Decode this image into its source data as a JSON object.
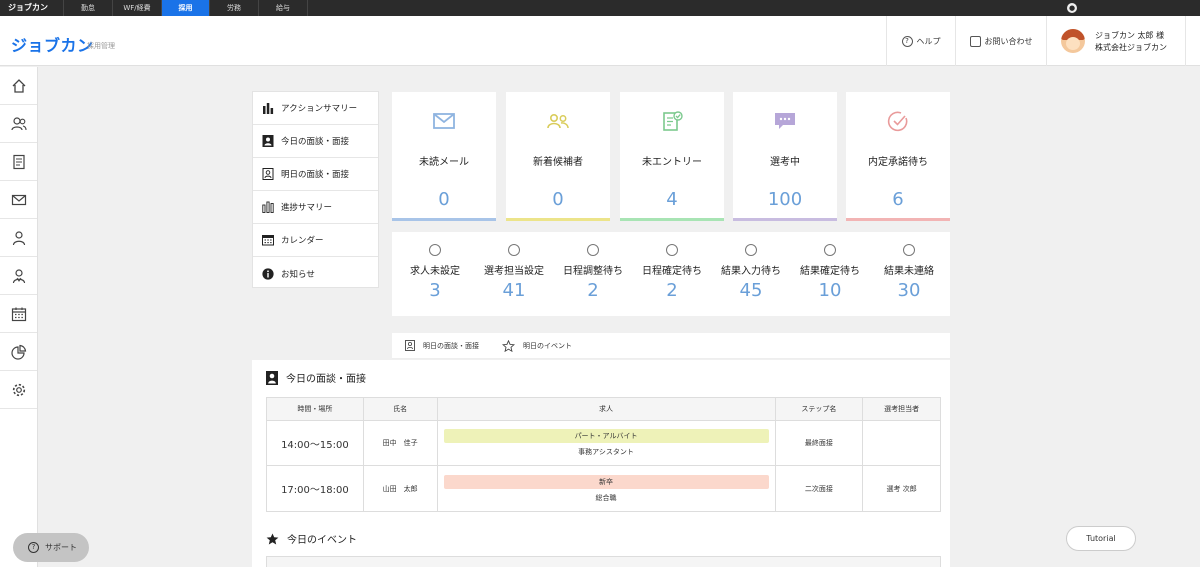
{
  "topbar": {
    "brand": "ジョブカン",
    "tabs": [
      "勤怠",
      "WF/経費",
      "採用",
      "労務",
      "給与"
    ],
    "active_tab": "採用"
  },
  "header": {
    "logo": "ジョブカン",
    "logo_sub": "採用管理",
    "help_label": "ヘルプ",
    "contact_label": "お問い合わせ",
    "user_name": "ジョブカン 太郎 様",
    "company": "株式会社ジョブカン"
  },
  "leftnav": {
    "icons": [
      "home-icon",
      "candidates-icon",
      "document-icon",
      "mail-icon",
      "person-icon",
      "users-icon",
      "calendar-icon",
      "pie-chart-icon",
      "gear-icon"
    ]
  },
  "summary_menu": [
    {
      "label": "アクションサマリー",
      "icon": "bar-chart-icon"
    },
    {
      "label": "今日の面談・面接",
      "icon": "person-card-dark-icon"
    },
    {
      "label": "明日の面談・面接",
      "icon": "person-card-icon"
    },
    {
      "label": "進捗サマリー",
      "icon": "progress-bars-icon"
    },
    {
      "label": "カレンダー",
      "icon": "calendar-icon"
    },
    {
      "label": "お知らせ",
      "icon": "info-icon"
    }
  ],
  "cards": [
    {
      "label": "未読メール",
      "value": "0",
      "color": "#a8c4e8",
      "icon": "mail-icon"
    },
    {
      "label": "新着候補者",
      "value": "0",
      "color": "#ece48a",
      "icon": "new-candidates-icon"
    },
    {
      "label": "未エントリー",
      "value": "4",
      "color": "#a8e4b4",
      "icon": "clipboard-check-icon"
    },
    {
      "label": "選考中",
      "value": "100",
      "color": "#c8bce0",
      "icon": "chat-bubble-icon"
    },
    {
      "label": "内定承諾待ち",
      "value": "6",
      "color": "#f2b4b4",
      "icon": "check-circle-icon"
    }
  ],
  "stats": [
    {
      "label": "求人未設定",
      "value": "3"
    },
    {
      "label": "選考担当設定",
      "value": "41"
    },
    {
      "label": "日程調整待ち",
      "value": "2"
    },
    {
      "label": "日程確定待ち",
      "value": "2"
    },
    {
      "label": "結果入力待ち",
      "value": "45"
    },
    {
      "label": "結果確定待ち",
      "value": "10"
    },
    {
      "label": "結果未連絡",
      "value": "30"
    }
  ],
  "tabs": {
    "tomorrow_interviews": "明日の面談・面接",
    "tomorrow_events": "明日のイベント"
  },
  "today_interviews": {
    "title": "今日の面談・面接",
    "headers": [
      "時間・場所",
      "氏名",
      "求人",
      "ステップ名",
      "選考担当者"
    ],
    "rows": [
      {
        "time": "14:00〜15:00",
        "name": "田中　佳子",
        "tag": "パート・アルバイト",
        "tag_color": "#eef2b8",
        "job": "事務アシスタント",
        "step": "最終面接",
        "staff": ""
      },
      {
        "time": "17:00〜18:00",
        "name": "山田　太郎",
        "tag": "新卒",
        "tag_color": "#fbd8cc",
        "job": "総合職",
        "step": "二次面接",
        "staff": "選考 次郎"
      }
    ]
  },
  "today_events": {
    "title": "今日のイベント"
  },
  "support_label": "サポート",
  "tutorial_label": "Tutorial"
}
